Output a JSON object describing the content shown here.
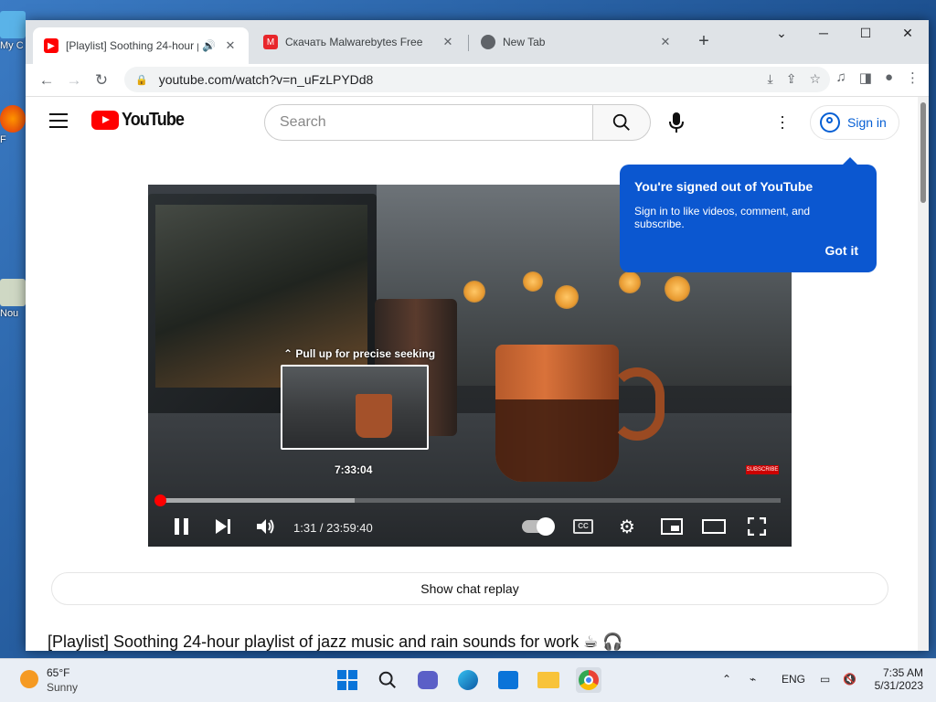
{
  "desktop": {
    "icons": [
      {
        "label": "My C"
      },
      {
        "label": "F"
      },
      {
        "label": "Nou"
      }
    ]
  },
  "browser": {
    "tabs": [
      {
        "title": "[Playlist] Soothing 24-hour p",
        "close": "✕",
        "favicon": "youtube-favicon",
        "active": true
      },
      {
        "title": "Скачать Malwarebytes Free",
        "close": "✕",
        "favicon": "malwarebytes-favicon"
      },
      {
        "title": "New Tab",
        "close": "✕",
        "favicon": "chrome-favicon"
      }
    ],
    "new_tab": "+",
    "url": "youtube.com/watch?v=n_uFzLPYDd8"
  },
  "youtube": {
    "logo_text": "YouTube",
    "search_placeholder": "Search",
    "sign_in": "Sign in",
    "popup": {
      "title": "You're signed out of YouTube",
      "body": "Sign in to like videos, comment, and subscribe.",
      "button": "Got it"
    },
    "player": {
      "seek_hint": "Pull up for precise seeking",
      "seek_preview_time": "7:33:04",
      "time_display": "1:31 / 23:59:40",
      "played_fraction": 0.001,
      "hover_fraction": 0.315,
      "subscribe_badge": "SUBSCRIBE",
      "cc_label": "CC"
    },
    "show_chat_replay": "Show chat replay",
    "video_title": "[Playlist] Soothing 24-hour playlist of jazz music and rain sounds for work",
    "title_emoji": "☕ 🎧"
  },
  "taskbar": {
    "weather_temp": "65°F",
    "weather_desc": "Sunny",
    "lang": "ENG",
    "time": "7:35 AM",
    "date": "5/31/2023"
  },
  "colors": {
    "yt_red": "#ff0000",
    "popup_blue": "#0b57d0",
    "link_blue": "#065fd4"
  }
}
